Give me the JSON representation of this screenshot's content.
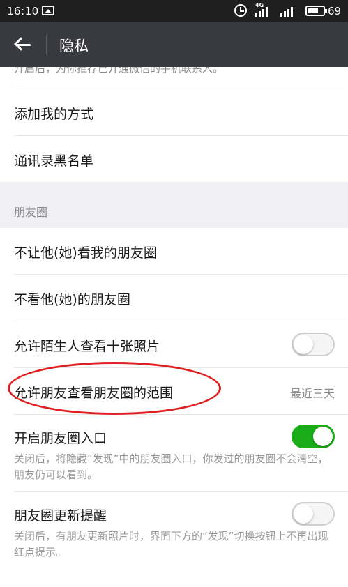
{
  "status_bar": {
    "time": "16:10",
    "network": "4G",
    "battery": "69",
    "battery_level": 0.69
  },
  "header": {
    "title": "隐私"
  },
  "partial_text": "开启后，为你推荐已开通微信的手机联系人。",
  "items_top": [
    {
      "label": "添加我的方式"
    },
    {
      "label": "通讯录黑名单"
    }
  ],
  "section": {
    "title": "朋友圈"
  },
  "moments": {
    "not_let_see": "不让他(她)看我的朋友圈",
    "not_see": "不看他(她)的朋友圈",
    "strangers": {
      "label": "允许陌生人查看十张照片",
      "enabled": false
    },
    "range": {
      "label": "允许朋友查看朋友圈的范围",
      "value": "最近三天"
    },
    "entry": {
      "label": "开启朋友圈入口",
      "enabled": true,
      "desc": "关闭后，将隐藏“发现”中的朋友圈入口，你发过的朋友圈不会清空，朋友仍可以看到。"
    },
    "update": {
      "label": "朋友圈更新提醒",
      "enabled": false,
      "desc": "关闭后，有朋友更新照片时，界面下方的“发现”切换按钮上不再出现红点提示。"
    }
  },
  "colors": {
    "status_bar_bg": "#1f1f1f",
    "action_bar_bg": "#393a3f",
    "toggle_on": "#1aad19",
    "annotation": "#e02020",
    "section_bg": "#efeff4"
  }
}
